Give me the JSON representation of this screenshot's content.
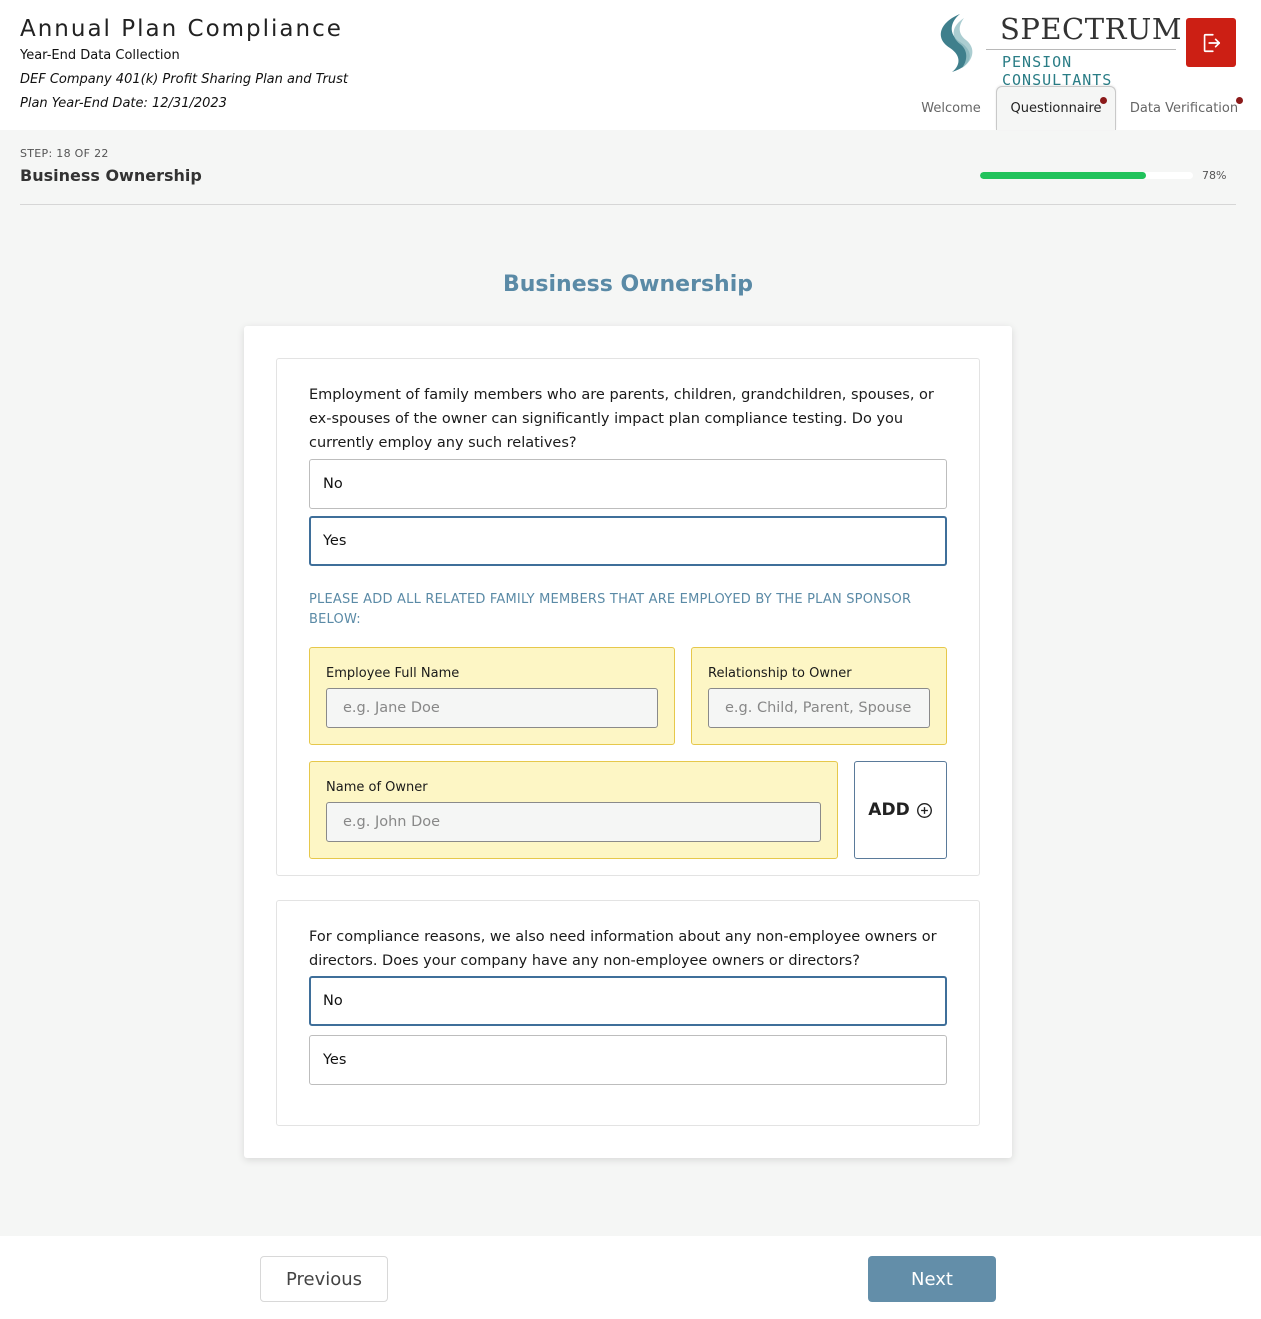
{
  "header": {
    "title": "Annual Plan Compliance",
    "subtitle": "Year-End Data Collection",
    "plan_name": "DEF Company 401(k) Profit Sharing Plan and Trust",
    "plan_year_end": "Plan Year-End Date: 12/31/2023",
    "logo": {
      "main": "SPECTRUM",
      "sub": "PENSION CONSULTANTS"
    },
    "logout_icon": "logout-icon",
    "tabs": [
      {
        "label": "Welcome",
        "active": false,
        "has_dot": false
      },
      {
        "label": "Questionnaire",
        "active": true,
        "has_dot": true
      },
      {
        "label": "Data Verification",
        "active": false,
        "has_dot": true
      }
    ]
  },
  "step": {
    "label": "STEP: 18 OF 22",
    "title": "Business Ownership",
    "progress": 0.78,
    "progress_text": "78%"
  },
  "section": {
    "heading": "Business Ownership"
  },
  "questions": [
    {
      "text": "Employment of family members who are parents, children, grandchildren, spouses, or ex-spouses of the owner can significantly impact plan compliance testing. Do you currently employ any such relatives?",
      "options": [
        {
          "label": "No",
          "selected": false
        },
        {
          "label": "Yes",
          "selected": true
        }
      ],
      "instruction": "PLEASE ADD ALL RELATED FAMILY MEMBERS THAT ARE EMPLOYED BY THE PLAN SPONSOR BELOW:",
      "fields": {
        "employee_name": {
          "label": "Employee Full Name",
          "placeholder": "e.g. Jane Doe",
          "value": ""
        },
        "relationship": {
          "label": "Relationship to Owner",
          "placeholder": "e.g. Child, Parent, Spouse",
          "value": ""
        },
        "owner_name": {
          "label": "Name of Owner",
          "placeholder": "e.g. John Doe",
          "value": ""
        }
      },
      "add_label": "ADD"
    },
    {
      "text": "For compliance reasons, we also need information about any non-employee owners or directors. Does your company have any non-employee owners or directors?",
      "options": [
        {
          "label": "No",
          "selected": true
        },
        {
          "label": "Yes",
          "selected": false
        }
      ]
    }
  ],
  "footer": {
    "previous_label": "Previous",
    "next_label": "Next"
  },
  "colors": {
    "accent": "#5a8aa6",
    "progress": "#21c25b",
    "logout": "#cc1f14",
    "field_bg": "#fdf6c5",
    "next_button": "#638ea9",
    "tab_dot": "#8b1a1a"
  }
}
